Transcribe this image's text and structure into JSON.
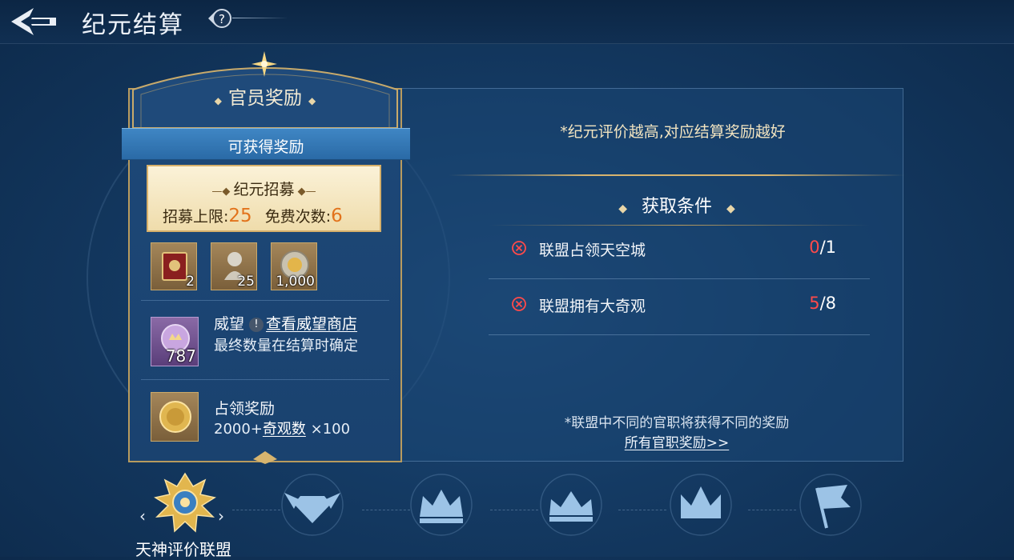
{
  "header": {
    "title": "纪元结算",
    "help_icon": "question-icon"
  },
  "left_card": {
    "title": "官员奖励",
    "ribbon_label": "可获得奖励",
    "recruit": {
      "title": "纪元招募",
      "limit_label": "招募上限:",
      "limit_value": "25",
      "free_label": "免费次数:",
      "free_value": "6"
    },
    "items": [
      {
        "icon": "book-icon",
        "qty": "2"
      },
      {
        "icon": "statue-bust-icon",
        "qty": "25"
      },
      {
        "icon": "gold-coin-icon",
        "qty": "1,000"
      }
    ],
    "prestige": {
      "qty": "787",
      "name": "威望",
      "info_icon": "!",
      "link": "查看威望商店",
      "desc": "最终数量在结算时确定"
    },
    "occupy": {
      "name": "占领奖励",
      "desc_prefix": "2000+",
      "desc_link": "奇观数",
      "desc_suffix": " ×100"
    }
  },
  "right_panel": {
    "tip": "*纪元评价越高,对应结算奖励越好",
    "conditions_title": "获取条件",
    "conditions": [
      {
        "text": "联盟占领天空城",
        "current": "0",
        "total": "/1"
      },
      {
        "text": "联盟拥有大奇观",
        "current": "5",
        "total": "/8"
      }
    ],
    "bottom_tip": "*联盟中不同的官职将获得不同的奖励",
    "bottom_link": "所有官职奖励>>"
  },
  "ranks": {
    "selected_label": "天神评价联盟",
    "tabs": [
      "sun-laurel-emblem",
      "winged-diamond-emblem",
      "jeweled-crown-emblem",
      "fleur-crown-emblem",
      "simple-crown-emblem",
      "flag-emblem"
    ]
  },
  "colors": {
    "accent_gold": "#d7b46e",
    "warning_red": "#ff4a4a",
    "number_orange": "#e2731c"
  }
}
